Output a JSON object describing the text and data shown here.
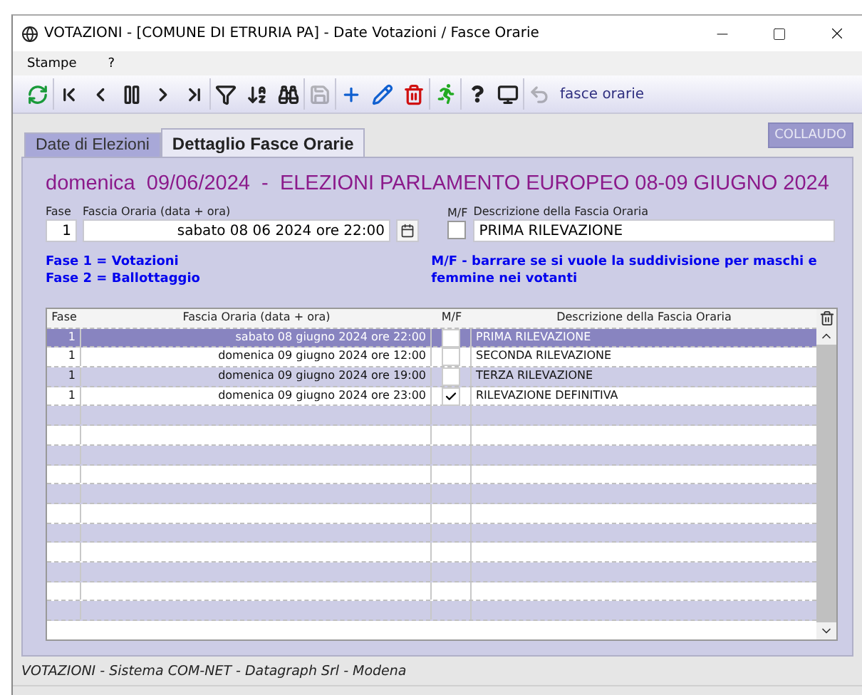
{
  "window": {
    "title": "VOTAZIONI - [COMUNE DI ETRURIA PA] - Date Votazioni / Fasce Orarie"
  },
  "menu": [
    "Stampe",
    "?"
  ],
  "toolbar": [
    {
      "kind": "refresh",
      "disabled": false
    },
    {
      "kind": "first",
      "disabled": false
    },
    {
      "kind": "prev",
      "disabled": false
    },
    {
      "kind": "pause",
      "disabled": false
    },
    {
      "kind": "next",
      "disabled": false
    },
    {
      "kind": "last",
      "disabled": false
    },
    {
      "kind": "filter",
      "disabled": false
    },
    {
      "kind": "sort",
      "disabled": false
    },
    {
      "kind": "search",
      "disabled": false
    },
    {
      "kind": "save",
      "disabled": true
    },
    {
      "kind": "add",
      "disabled": false
    },
    {
      "kind": "edit",
      "disabled": false
    },
    {
      "kind": "delete",
      "disabled": false
    },
    {
      "kind": "run",
      "disabled": false
    },
    {
      "kind": "help",
      "disabled": false
    },
    {
      "kind": "monitor",
      "disabled": false
    },
    {
      "kind": "undo",
      "disabled": true
    }
  ],
  "toolbar_label": "fasce orarie",
  "tabs": [
    {
      "label": "Date di Elezioni",
      "selected": false
    },
    {
      "label": "Dettaglio Fasce Orarie",
      "selected": true
    }
  ],
  "mode_badge": "COLLAUDO",
  "heading": "domenica  09/06/2024  -  ELEZIONI PARLAMENTO EUROPEO 08-09 GIUGNO 2024",
  "form": {
    "fase": {
      "label": "Fase",
      "value": "1"
    },
    "fascia": {
      "label": "Fascia Oraria (data + ora)",
      "value": "sabato 08 06 2024 ore 22:00"
    },
    "mf": {
      "label": "M/F",
      "checked": false
    },
    "descrizione": {
      "label": "Descrizione della Fascia Oraria",
      "value": "PRIMA RILEVAZIONE"
    }
  },
  "notes_left": [
    "Fase 1 = Votazioni",
    "Fase 2 = Ballottaggio"
  ],
  "note_right": "M/F - barrare se si vuole la suddivisione per maschi e femmine nei votanti",
  "table": {
    "columns": [
      "Fase",
      "Fascia Oraria (data + ora)",
      "M/F",
      "Descrizione della Fascia Oraria"
    ],
    "rows": [
      {
        "fase": "1",
        "fascia": "sabato 08 giugno 2024 ore 22:00",
        "mf": false,
        "descrizione": "PRIMA RILEVAZIONE",
        "selected": true
      },
      {
        "fase": "1",
        "fascia": "domenica 09 giugno 2024 ore 12:00",
        "mf": false,
        "descrizione": "SECONDA RILEVAZIONE",
        "selected": false
      },
      {
        "fase": "1",
        "fascia": "domenica 09 giugno 2024 ore 19:00",
        "mf": false,
        "descrizione": "TERZA RILEVAZIONE",
        "selected": false
      },
      {
        "fase": "1",
        "fascia": "domenica 09 giugno 2024 ore 23:00",
        "mf": true,
        "descrizione": "RILEVAZIONE DEFINITIVA",
        "selected": false
      }
    ]
  },
  "status_bar": "VOTAZIONI - Sistema COM-NET - Datagraph Srl - Modena"
}
